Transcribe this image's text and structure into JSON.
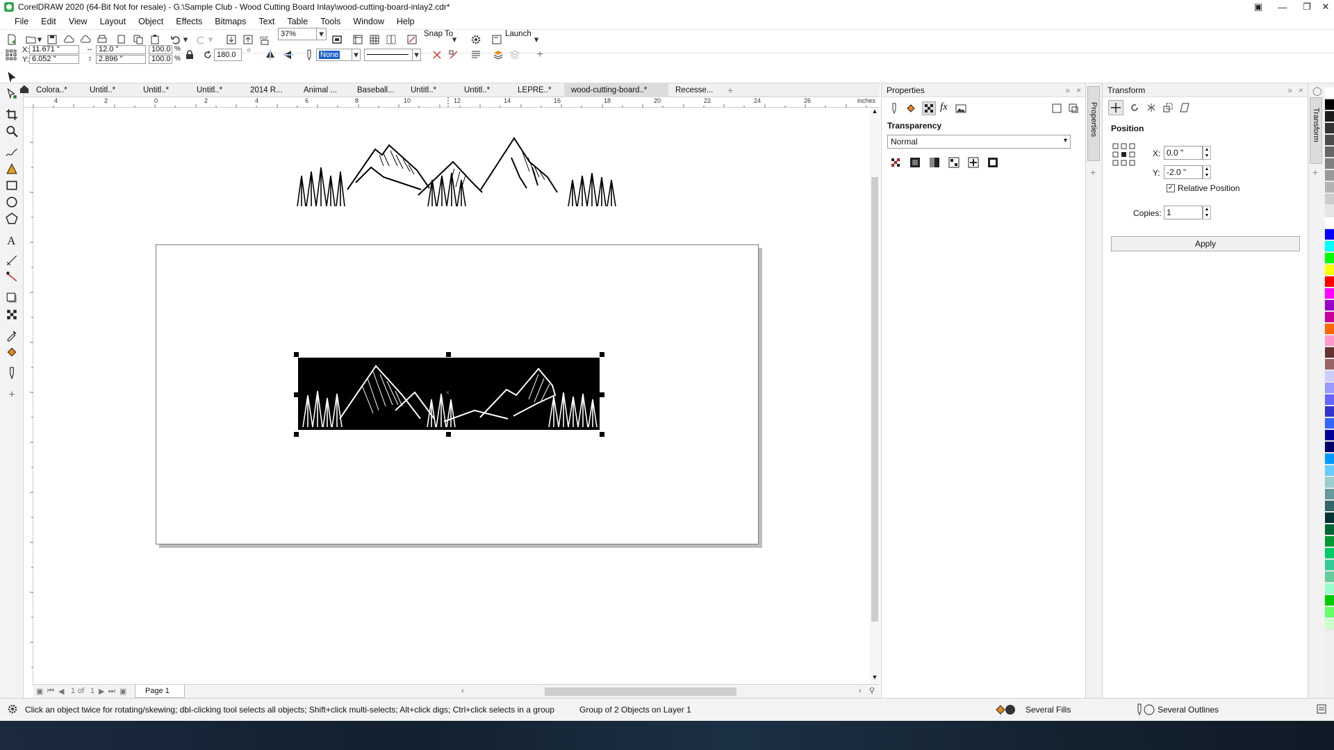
{
  "window": {
    "title": "CorelDRAW 2020 (64-Bit Not for resale) - G:\\Sample Club - Wood Cutting Board Inlay\\wood-cutting-board-inlay2.cdr*"
  },
  "menu": [
    "File",
    "Edit",
    "View",
    "Layout",
    "Object",
    "Effects",
    "Bitmaps",
    "Text",
    "Table",
    "Tools",
    "Window",
    "Help"
  ],
  "toolbar": {
    "zoom": "37%",
    "snap_to": "Snap To",
    "launch": "Launch"
  },
  "property_bar": {
    "x": "11.671 \"",
    "y": "6.052 \"",
    "width": "12.0 \"",
    "height": "2.896 \"",
    "scale_w": "100.0",
    "scale_h": "100.0",
    "percent": "%",
    "rotation": "180.0",
    "outline_width": "None",
    "x_label": "X:",
    "y_label": "Y:"
  },
  "doc_tabs": [
    "Colora..*",
    "Untitl..*",
    "Untitl..*",
    "Untitl..*",
    "2014 R...",
    "Animal ...",
    "Baseball...",
    "Untitl..*",
    "Untitl..*",
    "LEPRE..*",
    "wood-cutting-board..*",
    "Recesse..."
  ],
  "active_tab_index": 10,
  "ruler": {
    "units": "inches",
    "h_ticks": [
      "4",
      "2",
      "0",
      "2",
      "4",
      "6",
      "8",
      "10",
      "12",
      "14",
      "16",
      "18",
      "20",
      "22",
      "24",
      "26"
    ]
  },
  "page_nav": {
    "current": "1",
    "of": "of",
    "total": "1",
    "page_tab": "Page 1"
  },
  "properties_panel": {
    "title": "Properties",
    "section": "Transparency",
    "merge_mode": "Normal",
    "side_tab": "Properties"
  },
  "transform_panel": {
    "title": "Transform",
    "section": "Position",
    "x_label": "X:",
    "x_value": "0.0 \"",
    "y_label": "Y:",
    "y_value": "-2.0 \"",
    "relative_position": "Relative Position",
    "copies_label": "Copies:",
    "copies_value": "1",
    "apply": "Apply",
    "side_tab": "Transform"
  },
  "status": {
    "hint": "Click an object twice for rotating/skewing; dbl-clicking tool selects all objects; Shift+click multi-selects; Alt+click digs; Ctrl+click selects in a group",
    "selection": "Group of 2 Objects on Layer 1",
    "fill": "Several Fills",
    "outline": "Several Outlines"
  },
  "palette": [
    "#ffffff",
    "#000000",
    "#1a1a1a",
    "#333333",
    "#4d4d4d",
    "#666666",
    "#808080",
    "#999999",
    "#b3b3b3",
    "#cccccc",
    "#e6e6e6",
    "#ffffff",
    "#0000ff",
    "#00ffff",
    "#00ff00",
    "#ffff00",
    "#ff0000",
    "#ff00ff",
    "#9900cc",
    "#cc0099",
    "#ff6600",
    "#ff99cc",
    "#663333",
    "#996666",
    "#ccccff",
    "#9999ff",
    "#6666ff",
    "#3333cc",
    "#3366ff",
    "#000099",
    "#000066",
    "#0099ff",
    "#66ccff",
    "#99cccc",
    "#669999",
    "#336666",
    "#003333",
    "#006633",
    "#009933",
    "#00cc66",
    "#33cc99",
    "#66cc99",
    "#99ffcc",
    "#00cc00",
    "#66ff66",
    "#ccffcc"
  ]
}
